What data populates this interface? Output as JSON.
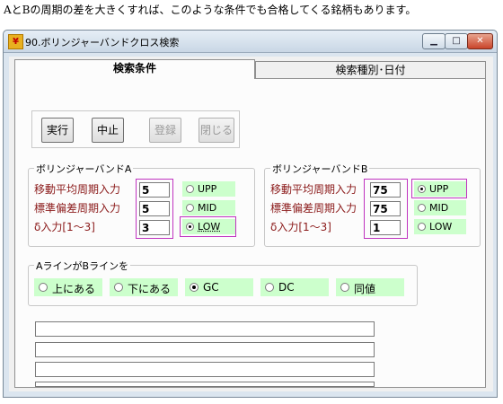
{
  "caption": "AとBの周期の差を大きくすれば、このような条件でも合格してくる銘柄もあります。",
  "window": {
    "title": "90.ボリンジャーバンドクロス検索",
    "minimize": "▁",
    "maximize": "□",
    "close": "✕"
  },
  "tabs": [
    {
      "label": "検索条件",
      "active": true
    },
    {
      "label": "検索種別･日付",
      "active": false
    }
  ],
  "buttons": {
    "run": "実行",
    "stop": "中止",
    "register": "登録",
    "close": "閉じる"
  },
  "bandA": {
    "legend": "ボリンジャーバンドA",
    "ma_label": "移動平均周期入力",
    "sd_label": "標準偏差周期入力",
    "delta_label": "δ入力[1～3]",
    "ma_value": "5",
    "sd_value": "5",
    "delta_value": "3",
    "options": [
      "UPP",
      "MID",
      "LOW"
    ],
    "selected": "LOW"
  },
  "bandB": {
    "legend": "ボリンジャーバンドB",
    "ma_label": "移動平均周期入力",
    "sd_label": "標準偏差周期入力",
    "delta_label": "δ入力[1～3]",
    "ma_value": "75",
    "sd_value": "75",
    "delta_value": "1",
    "options": [
      "UPP",
      "MID",
      "LOW"
    ],
    "selected": "UPP"
  },
  "relation": {
    "legend": "AラインがBラインを",
    "options": [
      "上にある",
      "下にある",
      "GC",
      "DC",
      "同値"
    ],
    "selected": "GC"
  },
  "colors": {
    "label_text": "#8b1a1a",
    "highlight": "#c033c0",
    "option_bg": "#ccffcc"
  }
}
